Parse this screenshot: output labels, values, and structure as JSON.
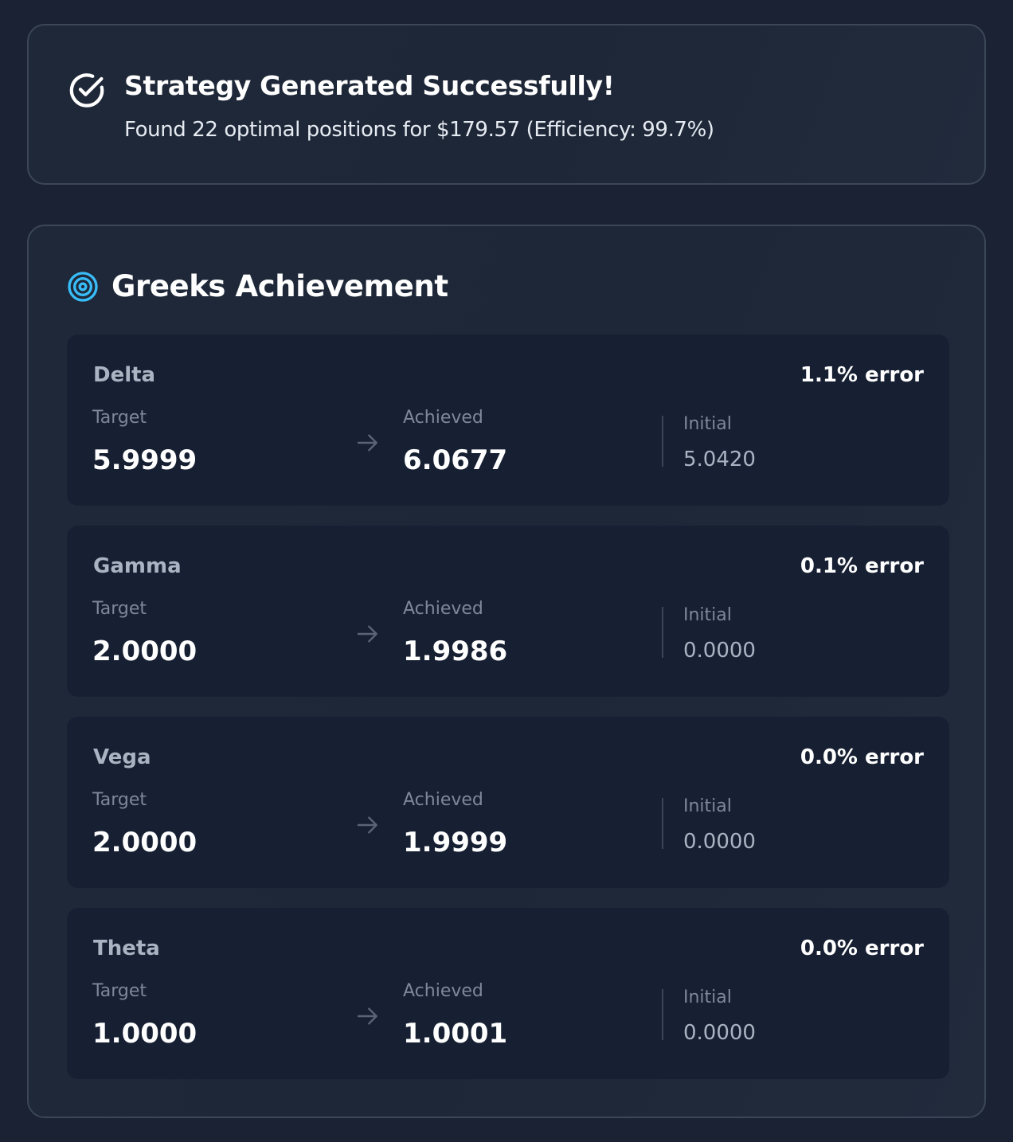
{
  "colors": {
    "background": "#1a2233",
    "card_border": "#3b4658",
    "row_background": "#172033",
    "accent_target_icon": "#38bdf8",
    "label_text": "#7d8899",
    "muted_text": "#aab3c1"
  },
  "success": {
    "icon": "check-circle-icon",
    "title": "Strategy Generated Successfully!",
    "subtitle": "Found 22 optimal positions for $179.57 (Efficiency: 99.7%)"
  },
  "greeks_section": {
    "icon": "target-icon",
    "title": "Greeks Achievement",
    "labels": {
      "target": "Target",
      "achieved": "Achieved",
      "initial": "Initial"
    },
    "rows": [
      {
        "name": "Delta",
        "error": "1.1% error",
        "target": "5.9999",
        "achieved": "6.0677",
        "initial": "5.0420"
      },
      {
        "name": "Gamma",
        "error": "0.1% error",
        "target": "2.0000",
        "achieved": "1.9986",
        "initial": "0.0000"
      },
      {
        "name": "Vega",
        "error": "0.0% error",
        "target": "2.0000",
        "achieved": "1.9999",
        "initial": "0.0000"
      },
      {
        "name": "Theta",
        "error": "0.0% error",
        "target": "1.0000",
        "achieved": "1.0001",
        "initial": "0.0000"
      }
    ]
  }
}
